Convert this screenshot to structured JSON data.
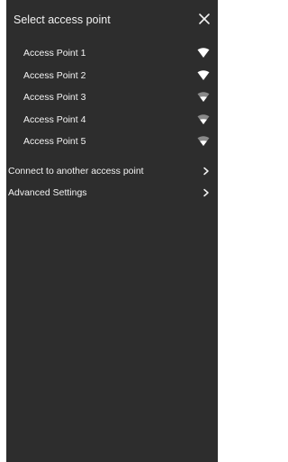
{
  "header": {
    "title": "Select access point",
    "close_icon": "close-icon"
  },
  "access_points": [
    {
      "label": "Access Point 1",
      "signal": 1.0,
      "icon": "wifi-strong-icon"
    },
    {
      "label": "Access Point 2",
      "signal": 1.0,
      "icon": "wifi-strong-icon"
    },
    {
      "label": "Access Point 3",
      "signal": 0.6,
      "icon": "wifi-medium-icon"
    },
    {
      "label": "Access Point 4",
      "signal": 0.6,
      "icon": "wifi-medium-icon"
    },
    {
      "label": "Access Point 5",
      "signal": 0.6,
      "icon": "wifi-medium-icon"
    }
  ],
  "nav": {
    "connect_label": "Connect to another access point",
    "advanced_label": "Advanced Settings",
    "chevron_icon": "chevron-right-icon"
  },
  "colors": {
    "panel_background": "#2d2d2d",
    "text": "#f4f4f4",
    "icon_active": "#ffffff",
    "icon_dim": "#8a8a8a"
  }
}
